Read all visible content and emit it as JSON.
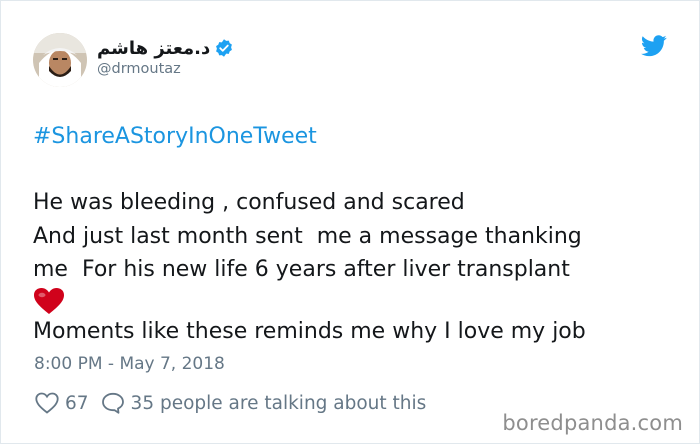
{
  "author": {
    "display_name": "د.معتز هاشم",
    "handle": "@drmoutaz",
    "verified": true
  },
  "tweet": {
    "hashtag": "#ShareAStoryInOneTweet",
    "lines": [
      "He was bleeding , confused and scared",
      "And just last month sent  me a message thanking",
      "me  For his new life 6 years after liver transplant",
      "Moments like these reminds me why I love my job"
    ],
    "emoji": "red-heart",
    "timestamp": "8:00 PM - May 7, 2018"
  },
  "engagement": {
    "likes": "67",
    "replies": "35 people are talking about this"
  },
  "watermark": "boredpanda.com",
  "colors": {
    "link": "#1b95e0",
    "text": "#14171a",
    "muted": "#657786",
    "heart": "#d0021b"
  },
  "icons": [
    "verified-badge-icon",
    "twitter-bird-icon",
    "heart-icon",
    "reply-bubble-icon"
  ]
}
